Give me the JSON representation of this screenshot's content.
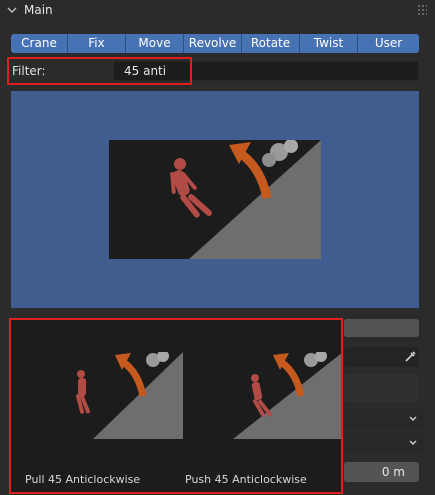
{
  "panel": {
    "title": "Main"
  },
  "categories": [
    "Crane",
    "Fix",
    "Move",
    "Revolve",
    "Rotate",
    "Twist",
    "User"
  ],
  "filter": {
    "label": "Filter:",
    "value": "45 anti"
  },
  "poses": [
    {
      "label": "Pull 45 Anticlockwise"
    },
    {
      "label": "Push 45 Anticlockwise"
    }
  ],
  "fields": {
    "distance_value": "0 m"
  },
  "colors": {
    "accent": "#4772b3",
    "highlight": "#e01e1e",
    "preview_bg": "#3f5e8f",
    "arrow": "#c65a1e",
    "floor": "#6e6e6e",
    "figure": "#b24a45"
  },
  "icons": [
    "chevron-down-icon",
    "drag-handle-icon",
    "eyedropper-icon"
  ]
}
